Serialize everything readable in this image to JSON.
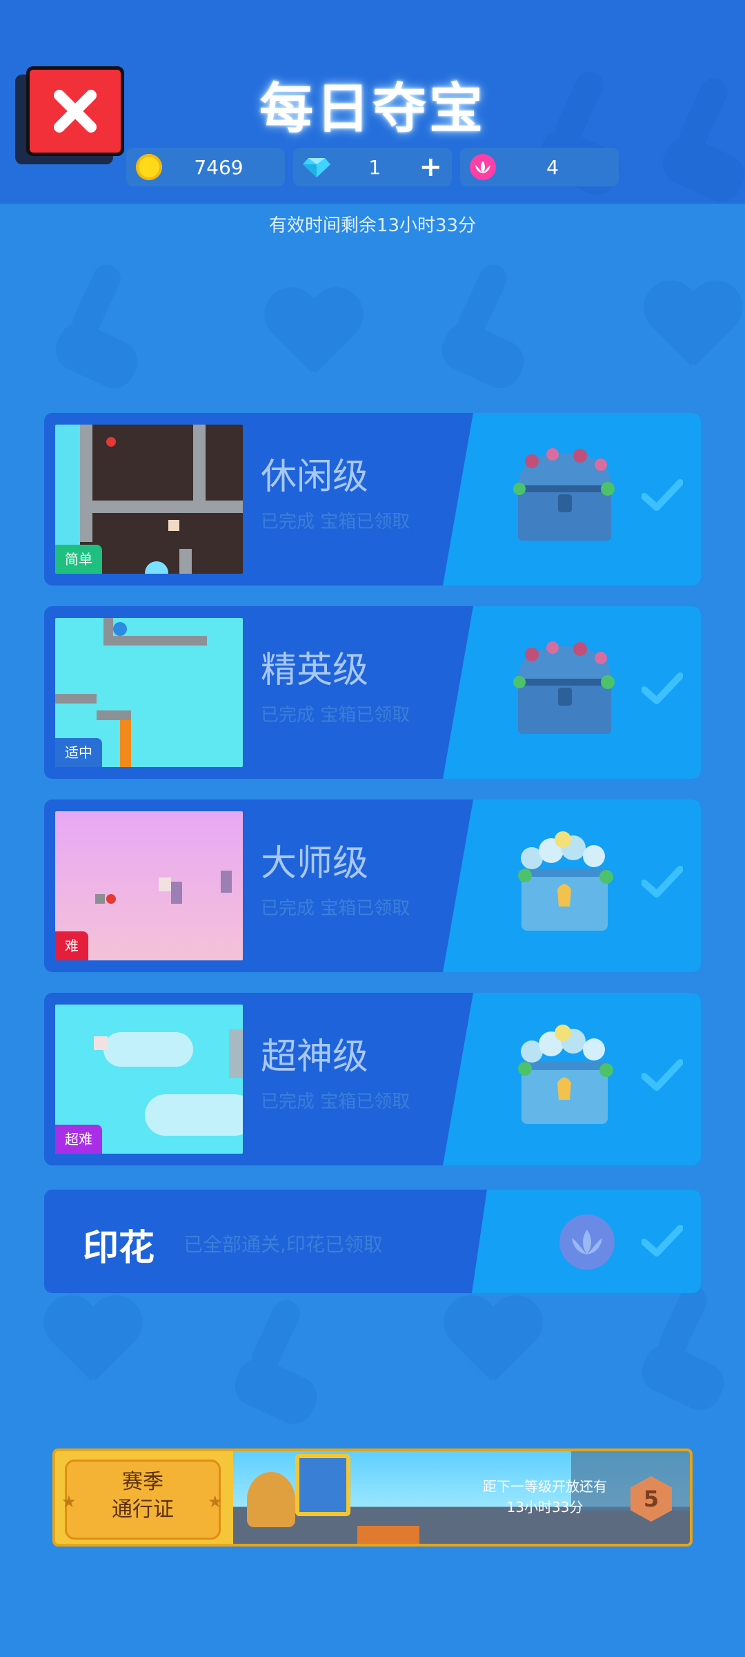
{
  "header": {
    "title": "每日夺宝",
    "coins": "7469",
    "gems": "1",
    "stamps": "4",
    "add_label": "+"
  },
  "timer": "有效时间剩余13小时33分",
  "levels": [
    {
      "title": "休闲级",
      "status": "已完成 宝箱已领取",
      "tag": "简单",
      "tag_color": "#1fc07f"
    },
    {
      "title": "精英级",
      "status": "已完成 宝箱已领取",
      "tag": "适中",
      "tag_color": "#2a6fd6"
    },
    {
      "title": "大师级",
      "status": "已完成 宝箱已领取",
      "tag": "难",
      "tag_color": "#e51e3c"
    },
    {
      "title": "超神级",
      "status": "已完成 宝箱已领取",
      "tag": "超难",
      "tag_color": "#a92ee8"
    }
  ],
  "stamp": {
    "title": "印花",
    "status": "已全部通关,印花已领取"
  },
  "pass": {
    "label_line1": "赛季",
    "label_line2": "通行证",
    "info_line1": "距下一等级开放还有",
    "info_line2": "13小时33分",
    "level": "5"
  },
  "colors": {
    "background": "#2a8ae6",
    "card": "#1e63da",
    "card_right": "#13a0f5",
    "close": "#f2303a"
  }
}
